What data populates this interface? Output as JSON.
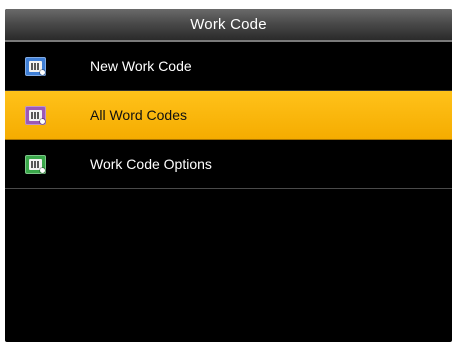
{
  "header": {
    "title": "Work Code"
  },
  "menu": {
    "items": [
      {
        "label": "New Work Code",
        "icon": "new-work-code-icon",
        "icon_color": "#3f7fd6",
        "selected": false
      },
      {
        "label": "All Word Codes",
        "icon": "all-work-codes-icon",
        "icon_color": "#9b59b6",
        "selected": true
      },
      {
        "label": "Work Code Options",
        "icon": "work-code-options-icon",
        "icon_color": "#3aa84a",
        "selected": false
      }
    ]
  },
  "colors": {
    "highlight": "#f5ac00",
    "background": "#000000"
  }
}
